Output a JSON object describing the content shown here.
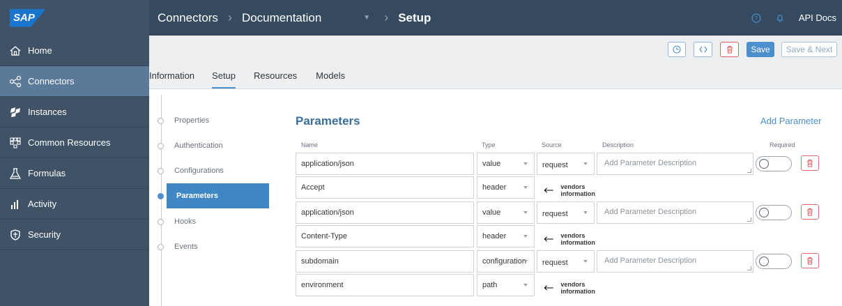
{
  "topbar": {
    "logo": "SAP",
    "breadcrumbs": [
      "Connectors",
      "Documentation",
      "Setup"
    ],
    "api_docs": "API Docs"
  },
  "sidebar": {
    "items": [
      {
        "label": "Home",
        "icon": "home-icon"
      },
      {
        "label": "Connectors",
        "icon": "connectors-icon",
        "active": true
      },
      {
        "label": "Instances",
        "icon": "instances-icon"
      },
      {
        "label": "Common Resources",
        "icon": "common-resources-icon"
      },
      {
        "label": "Formulas",
        "icon": "flask-icon"
      },
      {
        "label": "Activity",
        "icon": "bar-chart-icon"
      },
      {
        "label": "Security",
        "icon": "shield-icon"
      }
    ]
  },
  "toolbar": {
    "save_label": "Save",
    "save_next_label": "Save & Next"
  },
  "tabs": [
    "Information",
    "Setup",
    "Resources",
    "Models"
  ],
  "active_tab": "Setup",
  "steps": [
    "Properties",
    "Authentication",
    "Configurations",
    "Parameters",
    "Hooks",
    "Events"
  ],
  "active_step": "Parameters",
  "params": {
    "title": "Parameters",
    "add_label": "Add Parameter",
    "columns": {
      "name": "Name",
      "type": "Type",
      "source": "Source",
      "description": "Description",
      "required": "Required"
    },
    "desc_placeholder": "Add Parameter Description",
    "vendors_label": "vendors information",
    "groups": [
      {
        "name": "application/json",
        "type": "value",
        "source": "request",
        "vendor_name": "Accept",
        "vendor_type": "header"
      },
      {
        "name": "application/json",
        "type": "value",
        "source": "request",
        "vendor_name": "Content-Type",
        "vendor_type": "header"
      },
      {
        "name": "subdomain",
        "type": "configuration",
        "source": "request",
        "vendor_name": "environment",
        "vendor_type": "path"
      }
    ]
  },
  "colors": {
    "topbar": "#354a5f",
    "sidebar": "#3f5266",
    "active": "#5b7a99",
    "accent": "#4c8fcc",
    "danger": "#e05b5b"
  }
}
